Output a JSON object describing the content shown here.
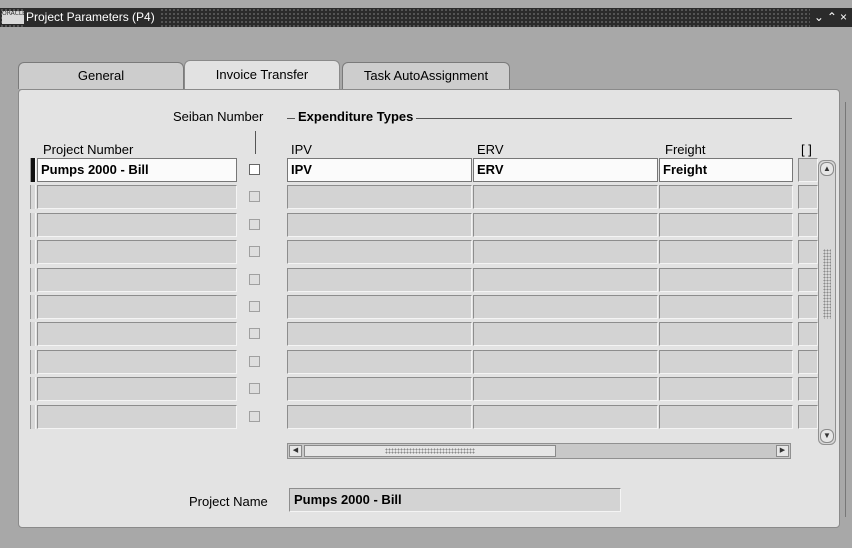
{
  "window": {
    "title": "Project Parameters (P4)",
    "logo_text": "ORACLE",
    "controls": "⌄ ⌃ ×"
  },
  "tabs": [
    {
      "label": "General",
      "active": false
    },
    {
      "label": "Invoice Transfer",
      "active": true
    },
    {
      "label": "Task AutoAssignment",
      "active": false
    }
  ],
  "form": {
    "seiban_label": "Seiban Number",
    "group_title": "Expenditure Types",
    "columns": {
      "project_number": "Project Number",
      "ipv": "IPV",
      "erv": "ERV",
      "freight": "Freight",
      "extra": "[ ]"
    },
    "rows": [
      {
        "project_number": "Pumps 2000 - Bill",
        "seiban": false,
        "ipv": "IPV",
        "erv": "ERV",
        "freight": "Freight",
        "current": true
      },
      {
        "project_number": "",
        "seiban": false,
        "ipv": "",
        "erv": "",
        "freight": "",
        "current": false
      },
      {
        "project_number": "",
        "seiban": false,
        "ipv": "",
        "erv": "",
        "freight": "",
        "current": false
      },
      {
        "project_number": "",
        "seiban": false,
        "ipv": "",
        "erv": "",
        "freight": "",
        "current": false
      },
      {
        "project_number": "",
        "seiban": false,
        "ipv": "",
        "erv": "",
        "freight": "",
        "current": false
      },
      {
        "project_number": "",
        "seiban": false,
        "ipv": "",
        "erv": "",
        "freight": "",
        "current": false
      },
      {
        "project_number": "",
        "seiban": false,
        "ipv": "",
        "erv": "",
        "freight": "",
        "current": false
      },
      {
        "project_number": "",
        "seiban": false,
        "ipv": "",
        "erv": "",
        "freight": "",
        "current": false
      },
      {
        "project_number": "",
        "seiban": false,
        "ipv": "",
        "erv": "",
        "freight": "",
        "current": false
      },
      {
        "project_number": "",
        "seiban": false,
        "ipv": "",
        "erv": "",
        "freight": "",
        "current": false
      }
    ],
    "project_name_label": "Project Name",
    "project_name_value": "Pumps 2000 - Bill"
  },
  "icons": {
    "scroll_up": "up-arrow-icon",
    "scroll_down": "down-arrow-icon",
    "scroll_left": "left-arrow-icon",
    "scroll_right": "right-arrow-icon"
  },
  "colors": {
    "title_bar": "#2b2b2b",
    "panel_bg": "#e3e3e3",
    "field_bg": "#d3d3d3",
    "active_field_bg": "#fbfbfb",
    "current_record_indicator": "#111111"
  }
}
